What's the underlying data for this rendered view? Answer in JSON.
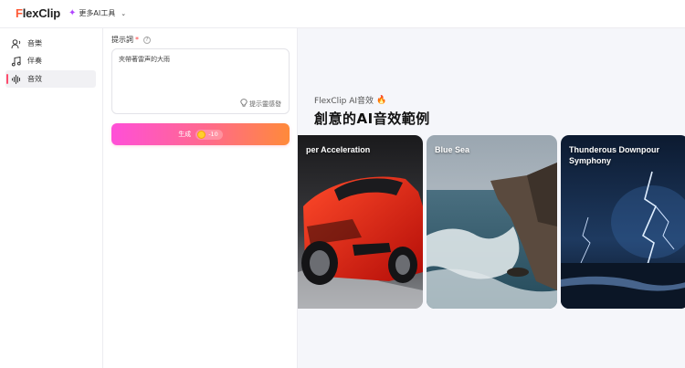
{
  "header": {
    "logo_first": "F",
    "logo_rest": "lexClip",
    "more_tools": "更多AI工具"
  },
  "nav": {
    "items": [
      {
        "label": "音樂",
        "icon": "voice-icon"
      },
      {
        "label": "伴奏",
        "icon": "music-note-icon"
      },
      {
        "label": "音效",
        "icon": "waveform-icon"
      }
    ]
  },
  "form": {
    "prompt_label": "提示詞",
    "required_mark": "*",
    "help_glyph": "?",
    "prompt_value": "夾帶著雷声的大雨",
    "inspire_label": "提示靈感發",
    "generate_label": "生成",
    "cost": "-10"
  },
  "showcase": {
    "subtitle": "FlexClip AI音效",
    "fire": "🔥",
    "title": "創意的AI音效範例",
    "cards": [
      {
        "label": "per Acceleration"
      },
      {
        "label": "Blue Sea"
      },
      {
        "label": "Thunderous Downpour Symphony"
      }
    ]
  },
  "colors": {
    "accent_pink": "#ff4fd8",
    "accent_orange": "#ff8a3a",
    "active_marker": "#ff4d6d"
  }
}
